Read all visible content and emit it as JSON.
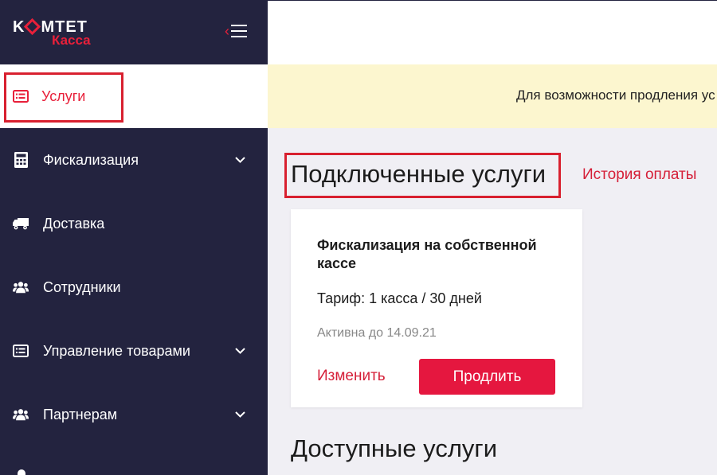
{
  "brand": {
    "logo_top_left": "K",
    "logo_top_right": "MTET",
    "logo_bottom": "Касса"
  },
  "sidebar": {
    "items": [
      {
        "label": "Услуги",
        "icon": "list-card-icon",
        "active": true
      },
      {
        "label": "Фискализация",
        "icon": "calculator-icon",
        "expandable": true
      },
      {
        "label": "Доставка",
        "icon": "truck-icon"
      },
      {
        "label": "Сотрудники",
        "icon": "users-icon"
      },
      {
        "label": "Управление товарами",
        "icon": "list-card-icon",
        "expandable": true
      },
      {
        "label": "Партнерам",
        "icon": "users-icon",
        "expandable": true
      }
    ]
  },
  "notice": {
    "text": "Для возможности продления ус"
  },
  "main": {
    "connected_title": "Подключенные услуги",
    "history_link": "История оплаты",
    "available_title": "Доступные услуги",
    "card": {
      "title": "Фискализация на собственной кассе",
      "tariff": "Тариф: 1 касса / 30 дней",
      "active_until": "Активна до 14.09.21",
      "change_label": "Изменить",
      "extend_label": "Продлить"
    }
  },
  "colors": {
    "sidebar_bg": "#23233f",
    "accent": "#e8203a",
    "notice_bg": "#fcf6cf",
    "content_bg": "#f0eff4"
  }
}
